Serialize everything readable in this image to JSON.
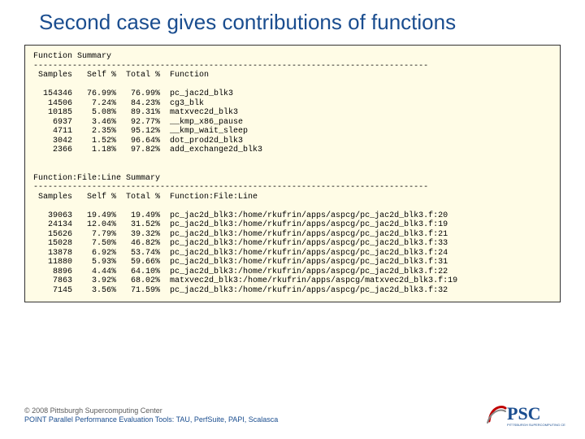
{
  "title": "Second case gives contributions of functions",
  "rule": "---------------------------------------------------------------------------------",
  "section1": {
    "title": "Function Summary",
    "header": " Samples   Self %  Total %  Function",
    "rows": [
      "  154346   76.99%   76.99%  pc_jac2d_blk3",
      "   14506    7.24%   84.23%  cg3_blk",
      "   10185    5.08%   89.31%  matxvec2d_blk3",
      "    6937    3.46%   92.77%  __kmp_x86_pause",
      "    4711    2.35%   95.12%  __kmp_wait_sleep",
      "    3042    1.52%   96.64%  dot_prod2d_blk3",
      "    2366    1.18%   97.82%  add_exchange2d_blk3"
    ]
  },
  "section2": {
    "title": "Function:File:Line Summary",
    "header": " Samples   Self %  Total %  Function:File:Line",
    "rows": [
      "   39063   19.49%   19.49%  pc_jac2d_blk3:/home/rkufrin/apps/aspcg/pc_jac2d_blk3.f:20",
      "   24134   12.04%   31.52%  pc_jac2d_blk3:/home/rkufrin/apps/aspcg/pc_jac2d_blk3.f:19",
      "   15626    7.79%   39.32%  pc_jac2d_blk3:/home/rkufrin/apps/aspcg/pc_jac2d_blk3.f:21",
      "   15028    7.50%   46.82%  pc_jac2d_blk3:/home/rkufrin/apps/aspcg/pc_jac2d_blk3.f:33",
      "   13878    6.92%   53.74%  pc_jac2d_blk3:/home/rkufrin/apps/aspcg/pc_jac2d_blk3.f:24",
      "   11880    5.93%   59.66%  pc_jac2d_blk3:/home/rkufrin/apps/aspcg/pc_jac2d_blk3.f:31",
      "    8896    4.44%   64.10%  pc_jac2d_blk3:/home/rkufrin/apps/aspcg/pc_jac2d_blk3.f:22",
      "    7863    3.92%   68.02%  matxvec2d_blk3:/home/rkufrin/apps/aspcg/matxvec2d_blk3.f:19",
      "    7145    3.56%   71.59%  pc_jac2d_blk3:/home/rkufrin/apps/aspcg/pc_jac2d_blk3.f:32"
    ]
  },
  "footer": {
    "copyright": "© 2008 Pittsburgh Supercomputing Center",
    "subtitle": "POINT Parallel Performance Evaluation Tools: TAU, PerfSuite, PAPI, Scalasca"
  }
}
